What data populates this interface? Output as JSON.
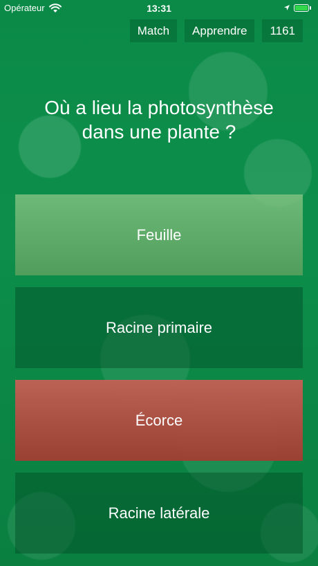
{
  "status_bar": {
    "carrier": "Opérateur",
    "time": "13:31",
    "battery_level": 1.0,
    "battery_color": "#32d74b"
  },
  "header": {
    "match_label": "Match",
    "learn_label": "Apprendre",
    "score": "1161"
  },
  "question": {
    "line1": "Où a lieu la photosynthèse",
    "line2": "dans une plante ?"
  },
  "answers": [
    {
      "label": "Feuille",
      "state": "correct"
    },
    {
      "label": "Racine primaire",
      "state": "neutral"
    },
    {
      "label": "Écorce",
      "state": "wrong"
    },
    {
      "label": "Racine latérale",
      "state": "neutral"
    }
  ],
  "colors": {
    "background": "#0d8f4b",
    "correct": "#73b577",
    "wrong": "#b0503f"
  }
}
